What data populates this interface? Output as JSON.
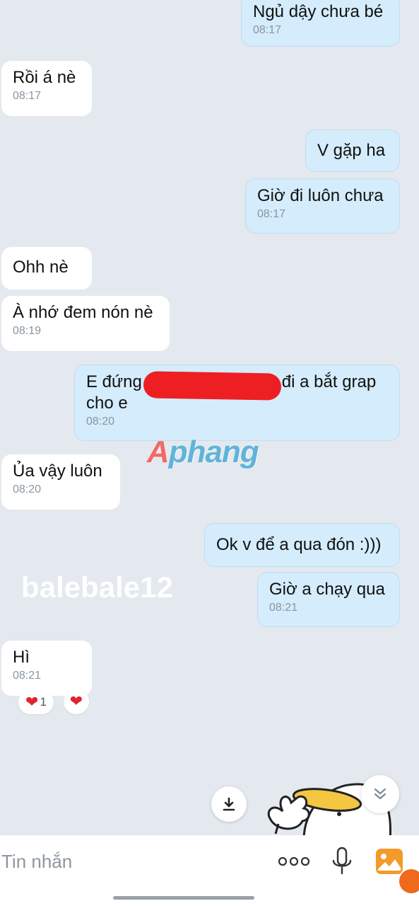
{
  "messages": [
    {
      "side": "out",
      "text": "Ngủ dậy chưa bé",
      "time": "08:17"
    },
    {
      "side": "in",
      "text": "Rồi á nè",
      "time": "08:17"
    },
    {
      "side": "out",
      "text": "V gặp ha",
      "time": ""
    },
    {
      "side": "out",
      "text": "Giờ đi luôn chưa",
      "time": "08:17"
    },
    {
      "side": "in",
      "text": "Ohh nè",
      "time": ""
    },
    {
      "side": "in",
      "text": "À nhớ đem nón nè",
      "time": "08:19"
    },
    {
      "side": "out",
      "text_before": "E đứng",
      "text_after": "đi a bắt grap",
      "text_line2": "cho e",
      "time": "08:20"
    },
    {
      "side": "in",
      "text": "Ủa vậy luôn",
      "time": "08:20"
    },
    {
      "side": "out",
      "text": "Ok v để a qua đón :)))",
      "time": ""
    },
    {
      "side": "out",
      "text": "Giờ a chạy qua",
      "time": "08:21"
    },
    {
      "side": "in",
      "text": "Hì",
      "time": "08:21"
    }
  ],
  "reactions": {
    "count": "1"
  },
  "watermarks": {
    "logo": "Aphang",
    "logo_first": "A",
    "logo_rest": "phang",
    "username": "balebale12"
  },
  "composer": {
    "placeholder": "Tin nhắn"
  },
  "icons": [
    "download-icon",
    "chevron-down-double-icon",
    "more-dots-icon",
    "microphone-icon",
    "image-icon",
    "heart-icon"
  ],
  "colors": {
    "incoming_bubble": "#ffffff",
    "outgoing_bubble": "#d4ecfb",
    "background": "#e4e9ef",
    "heart": "#e0242e",
    "redaction": "#ee1f23"
  }
}
